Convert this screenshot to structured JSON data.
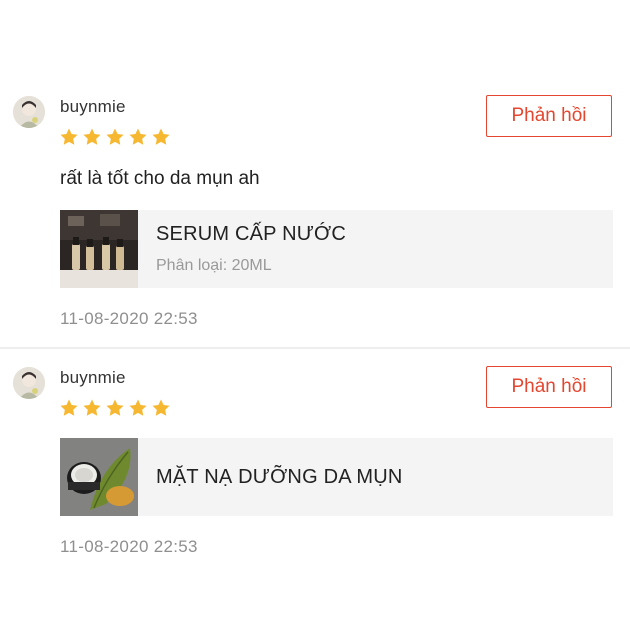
{
  "colors": {
    "accent": "#e4462f",
    "star": "#f6b731",
    "muted_text": "#8f8f8f",
    "product_background": "#f4f4f4"
  },
  "reviews": [
    {
      "username": "buynmie",
      "avatar_icon": "user-avatar",
      "rating": 5,
      "reply_label": "Phản hồi",
      "comment": "rất là tốt cho da mụn ah",
      "product": {
        "name": "SERUM CẤP NƯỚC",
        "variation": "Phân loại: 20ML",
        "thumbnail_icon": "serum-bottles-thumbnail"
      },
      "timestamp": "11-08-2020 22:53"
    },
    {
      "username": "buynmie",
      "avatar_icon": "user-avatar",
      "rating": 5,
      "reply_label": "Phản hồi",
      "product": {
        "name": "MẶT NẠ DƯỠNG DA MỤN",
        "thumbnail_icon": "mask-jar-thumbnail"
      },
      "timestamp": "11-08-2020 22:53"
    }
  ]
}
